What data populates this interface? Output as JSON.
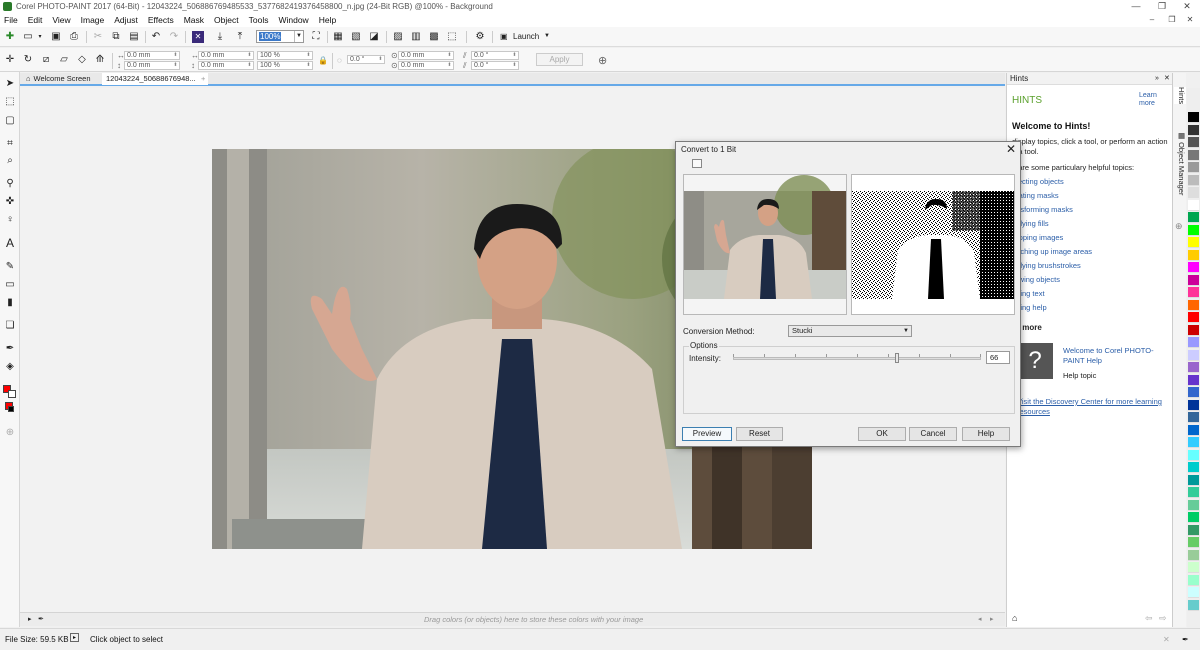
{
  "window": {
    "title": "Corel PHOTO-PAINT 2017 (64-Bit) - 12043224_506886769485533_5377682419376458800_n.jpg (24-Bit RGB) @100% - Background",
    "controls": {
      "minimize": "—",
      "restore": "❐",
      "close": "✕"
    }
  },
  "menu": {
    "items": [
      "File",
      "Edit",
      "View",
      "Image",
      "Adjust",
      "Effects",
      "Mask",
      "Object",
      "Tools",
      "Window",
      "Help"
    ],
    "mdi_controls": {
      "minimize": "–",
      "restore": "❐",
      "close": "✕"
    }
  },
  "toolbar": {
    "zoom_value": "100%",
    "launch_label": "Launch",
    "icons": [
      "new-icon",
      "open-icon",
      "save-icon",
      "print-icon",
      "cut-icon",
      "copy-icon",
      "paste-icon",
      "undo-icon",
      "redo-icon",
      "import-icon",
      "export-icon",
      "zoom-fit-icon",
      "options-icon"
    ]
  },
  "propbar": {
    "pos_x": "0.0 mm",
    "pos_y": "0.0 mm",
    "size_w": "0.0 mm",
    "size_h": "0.0 mm",
    "scale_w": "100 %",
    "scale_h": "100 %",
    "rotate": "0.0 °",
    "center_x": "0.0 mm",
    "center_y": "0.0 mm",
    "skew_h": "0.0 °",
    "skew_v": "0.0 °",
    "apply_label": "Apply"
  },
  "tabs": {
    "welcome": "Welcome Screen",
    "document": "12043224_50688676948..."
  },
  "canvas": {
    "drop_hint": "Drag colors (or objects) here to store these colors with your image"
  },
  "status": {
    "file_size": "File Size: 59.5 KB",
    "message": "Click object to select"
  },
  "hints": {
    "panel_title": "Hints",
    "heading": "HINTS",
    "learn_more_link": "Learn more",
    "welcome_title": "Welcome to Hints!",
    "intro": "display topics, click a tool, or perform an action n a tool.",
    "topics_intro": "e are some particulary helpful topics:",
    "topics": [
      "electing objects",
      "reating masks",
      "ansforming masks",
      "pplying fills",
      "ropping images",
      "ouching up image areas",
      "pplying brushstrokes",
      "rawing objects",
      "dding text",
      "etting help"
    ],
    "learn_more_heading": "rn more",
    "help_link": "Welcome to Corel PHOTO-PAINT Help",
    "help_sub": "Help topic",
    "discovery_link": "Visit the Discovery Center for more learning resources"
  },
  "docker_tabs": [
    "Hints",
    "Object Manager"
  ],
  "palette": {
    "colors": [
      "#000000",
      "#333333",
      "#555555",
      "#777777",
      "#999999",
      "#bbbbbb",
      "#dddddd",
      "#ffffff",
      "#00a651",
      "#00ff00",
      "#ffff00",
      "#ffcc00",
      "#ff00ff",
      "#cc0099",
      "#ff3399",
      "#ff6600",
      "#ff0000",
      "#cc0000",
      "#9999ff",
      "#ccccff",
      "#9966cc",
      "#6633cc",
      "#3366cc",
      "#003399",
      "#336699",
      "#0066cc",
      "#33ccff",
      "#66ffff",
      "#00cccc",
      "#009999",
      "#33cc99",
      "#66cc99",
      "#00cc66",
      "#339966",
      "#66cc66",
      "#99cc99",
      "#ccffcc",
      "#99ffcc",
      "#ccffff",
      "#66cccc"
    ]
  },
  "dialog": {
    "title": "Convert to 1 Bit",
    "conversion_label": "Conversion Method:",
    "conversion_value": "Stucki",
    "options_label": "Options",
    "intensity_label": "Intensity:",
    "intensity_value": "66",
    "intensity": 66,
    "buttons": {
      "preview": "Preview",
      "reset": "Reset",
      "ok": "OK",
      "cancel": "Cancel",
      "help": "Help"
    }
  }
}
